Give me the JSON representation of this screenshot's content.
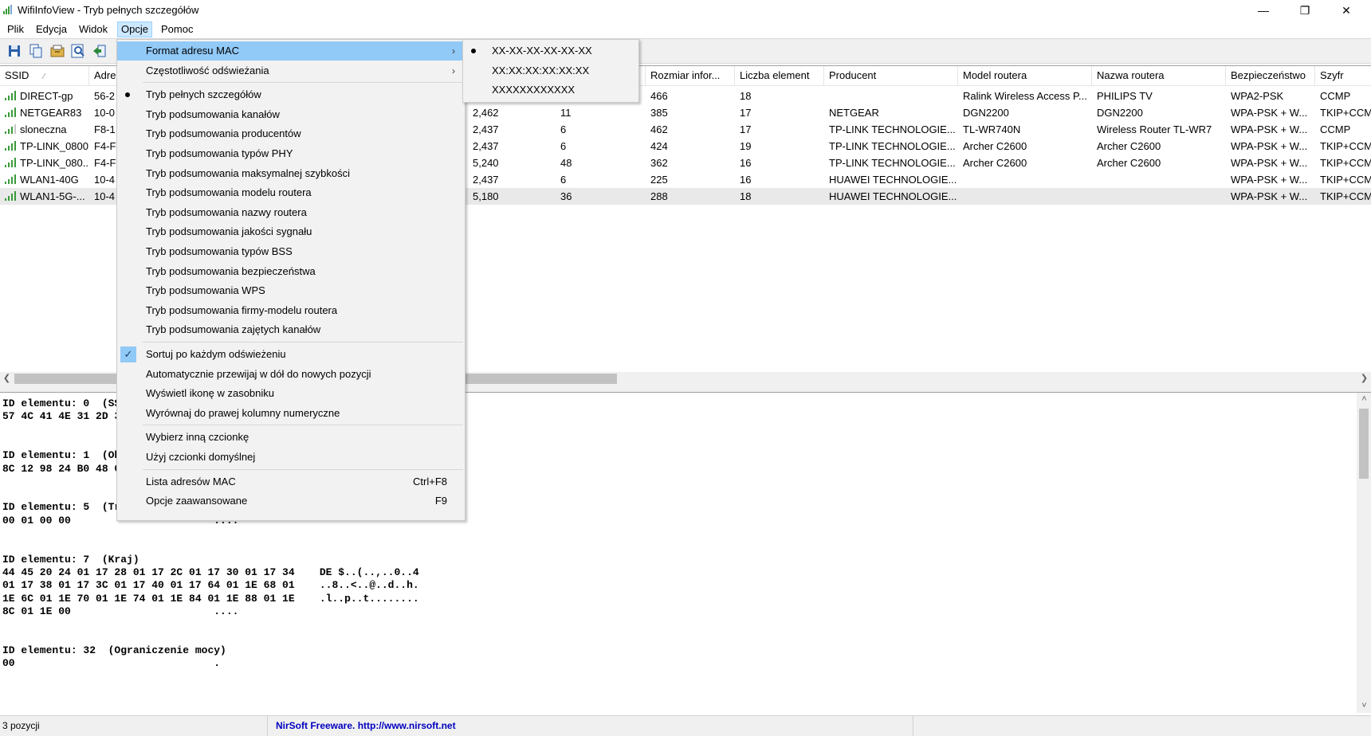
{
  "window": {
    "title": "WifiInfoView  -  Tryb pełnych szczegółów",
    "minimize": "—",
    "restore": "❐",
    "close": "✕"
  },
  "menubar": [
    "Plik",
    "Edycja",
    "Widok",
    "Opcje",
    "Pomoc"
  ],
  "toolbar": {
    "icons": [
      "save-icon",
      "copy-icon",
      "properties-icon",
      "find-icon",
      "exit-icon"
    ]
  },
  "columns": [
    "SSID",
    "Adre",
    "",
    "",
    "",
    "Rozmiar infor...",
    "Liczba element",
    "Producent",
    "Model routera",
    "Nazwa routera",
    "Bezpieczeństwo",
    "Szyfr"
  ],
  "sort_indicator": "⁄",
  "rows": [
    {
      "ssid": "DIRECT-gp",
      "mac": "56-2",
      "freq": "",
      "chan": "",
      "info": "466",
      "count": "18",
      "producer": "",
      "model": "Ralink Wireless Access P...",
      "router": "PHILIPS TV",
      "security": "WPA2-PSK",
      "cipher": "CCMP",
      "signal": 4
    },
    {
      "ssid": "NETGEAR83",
      "mac": "10-0",
      "freq": "2,462",
      "chan": "11",
      "info": "385",
      "count": "17",
      "producer": "NETGEAR",
      "model": "DGN2200",
      "router": "DGN2200",
      "security": "WPA-PSK + W...",
      "cipher": "TKIP+CCM",
      "signal": 4
    },
    {
      "ssid": "sloneczna",
      "mac": "F8-1",
      "freq": "2,437",
      "chan": "6",
      "info": "462",
      "count": "17",
      "producer": "TP-LINK TECHNOLOGIE...",
      "model": "TL-WR740N",
      "router": "Wireless Router TL-WR7",
      "security": "WPA-PSK + W...",
      "cipher": "CCMP",
      "signal": 3
    },
    {
      "ssid": "TP-LINK_0800",
      "mac": "F4-F",
      "freq": "2,437",
      "chan": "6",
      "info": "424",
      "count": "19",
      "producer": "TP-LINK TECHNOLOGIE...",
      "model": "Archer C2600",
      "router": "Archer C2600",
      "security": "WPA-PSK + W...",
      "cipher": "TKIP+CCM",
      "signal": 4
    },
    {
      "ssid": "TP-LINK_080...",
      "mac": "F4-F",
      "freq": "5,240",
      "chan": "48",
      "info": "362",
      "count": "16",
      "producer": "TP-LINK TECHNOLOGIE...",
      "model": "Archer C2600",
      "router": "Archer C2600",
      "security": "WPA-PSK + W...",
      "cipher": "TKIP+CCM",
      "signal": 4
    },
    {
      "ssid": "WLAN1-40G",
      "mac": "10-4",
      "freq": "2,437",
      "chan": "6",
      "info": "225",
      "count": "16",
      "producer": "HUAWEI TECHNOLOGIE...",
      "model": "",
      "router": "",
      "security": "WPA-PSK + W...",
      "cipher": "TKIP+CCM",
      "signal": 4
    },
    {
      "ssid": "WLAN1-5G-...",
      "mac": "10-4",
      "freq": "5,180",
      "chan": "36",
      "info": "288",
      "count": "18",
      "producer": "HUAWEI TECHNOLOGIE...",
      "model": "",
      "router": "",
      "security": "WPA-PSK + W...",
      "cipher": "TKIP+CCM",
      "signal": 4
    }
  ],
  "detail_lines": [
    "ID elementu: 0  (SSI",
    "57 4C 41 4E 31 2D 3",
    "",
    "",
    "ID elementu: 1  (Obs",
    "8C 12 98 24 B0 48 0",
    "",
    "",
    "ID elementu: 5  (Tra",
    "00 01 00 00                       ....",
    "",
    "",
    "ID elementu: 7  (Kraj)",
    "44 45 20 24 01 17 28 01 17 2C 01 17 30 01 17 34    DE $..(..,..0..4",
    "01 17 38 01 17 3C 01 17 40 01 17 64 01 1E 68 01    ..8..<..@..d..h.",
    "1E 6C 01 1E 70 01 1E 74 01 1E 84 01 1E 88 01 1E    .l..p..t........",
    "8C 01 1E 00                       ....",
    "",
    "",
    "ID elementu: 32  (Ograniczenie mocy)",
    "00                                .",
    ""
  ],
  "statusbar": {
    "count": "3 pozycji",
    "link": "NirSoft Freeware.  http://www.nirsoft.net"
  },
  "options_menu": [
    {
      "label": "Format adresu MAC",
      "submenu": true,
      "highlight": true
    },
    {
      "label": "Częstotliwość odświeżania",
      "submenu": true
    },
    {
      "sep": true
    },
    {
      "label": "Tryb pełnych szczegółów",
      "radio": true
    },
    {
      "label": "Tryb podsumowania kanałów"
    },
    {
      "label": "Tryb podsumowania producentów"
    },
    {
      "label": "Tryb podsumowania typów PHY"
    },
    {
      "label": "Tryb podsumowania maksymalnej szybkości"
    },
    {
      "label": "Tryb podsumowania modelu routera"
    },
    {
      "label": "Tryb podsumowania nazwy routera"
    },
    {
      "label": "Tryb podsumowania jakości sygnału"
    },
    {
      "label": "Tryb podsumowania typów BSS"
    },
    {
      "label": "Tryb podsumowania bezpieczeństwa"
    },
    {
      "label": "Tryb podsumowania WPS"
    },
    {
      "label": "Tryb podsumowania firmy-modelu routera"
    },
    {
      "label": "Tryb podsumowania zajętych kanałów"
    },
    {
      "sep": true
    },
    {
      "label": "Sortuj po każdym odświeżeniu",
      "check": true
    },
    {
      "label": "Automatycznie przewijaj w dół do nowych pozycji"
    },
    {
      "label": "Wyświetl ikonę w zasobniku"
    },
    {
      "label": "Wyrównaj do prawej kolumny numeryczne"
    },
    {
      "sep": true
    },
    {
      "label": "Wybierz inną czcionkę"
    },
    {
      "label": "Użyj czcionki domyślnej"
    },
    {
      "sep": true
    },
    {
      "label": "Lista adresów MAC",
      "shortcut": "Ctrl+F8"
    },
    {
      "label": "Opcje zaawansowane",
      "shortcut": "F9"
    }
  ],
  "mac_format_submenu": [
    {
      "label": "XX-XX-XX-XX-XX-XX",
      "radio": true
    },
    {
      "label": "XX:XX:XX:XX:XX:XX"
    },
    {
      "label": "XXXXXXXXXXXX"
    }
  ],
  "colors": {
    "menu_highlight": "#91c9f7",
    "link": "#0000c0",
    "signal": "#3a9a3a"
  }
}
